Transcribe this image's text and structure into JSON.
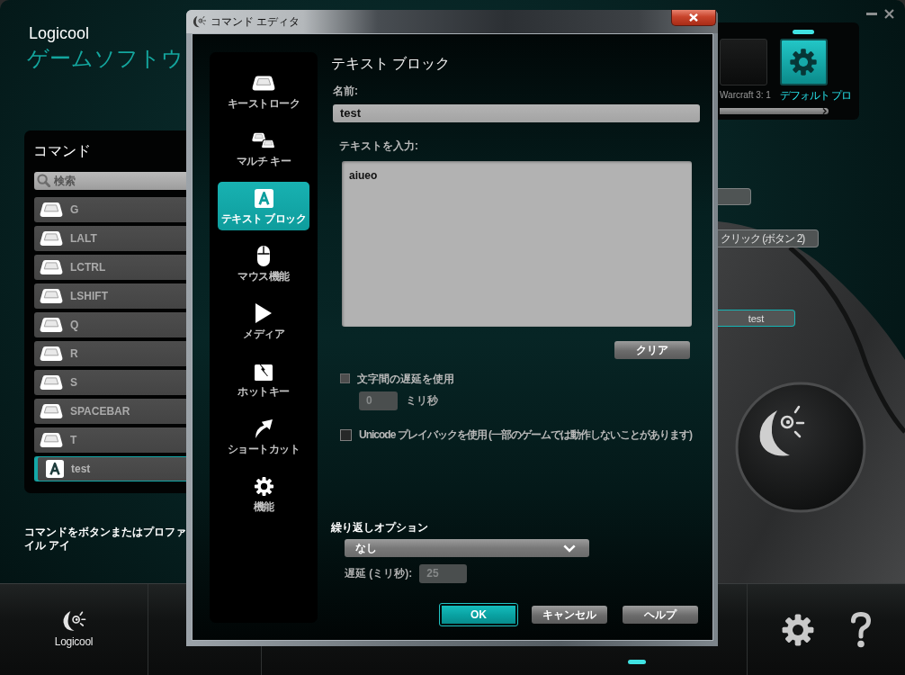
{
  "app": {
    "brand": "Logicool",
    "product_title": "ゲームソフトウ"
  },
  "commands": {
    "title": "コマンド",
    "search": {
      "placeholder": "検索"
    },
    "items": [
      {
        "label": "G",
        "kind": "key",
        "selected": false
      },
      {
        "label": "LALT",
        "kind": "key",
        "selected": false
      },
      {
        "label": "LCTRL",
        "kind": "key",
        "selected": false
      },
      {
        "label": "LSHIFT",
        "kind": "key",
        "selected": false
      },
      {
        "label": "Q",
        "kind": "key",
        "selected": false
      },
      {
        "label": "R",
        "kind": "key",
        "selected": false
      },
      {
        "label": "S",
        "kind": "key",
        "selected": false
      },
      {
        "label": "SPACEBAR",
        "kind": "key",
        "selected": false
      },
      {
        "label": "T",
        "kind": "key",
        "selected": false
      },
      {
        "label": "test",
        "kind": "text",
        "selected": true
      }
    ],
    "hint": "コマンドをボタンまたはプロファイル アイ"
  },
  "profiles": {
    "items": [
      {
        "label": "Warcraft 3: 1",
        "kind": "game",
        "selected": false
      },
      {
        "label": "デフォルト プロ",
        "kind": "default",
        "selected": true
      }
    ]
  },
  "assignments": [
    {
      "selected": false
    },
    {
      "label": "クリック (ボタン 2)",
      "selected": false
    },
    {
      "label": "test",
      "selected": true
    }
  ],
  "bottom_bar": {
    "brand": "Logicool"
  },
  "dialog": {
    "title": "コマンド エディタ",
    "nav": [
      {
        "label": "キーストローク",
        "kind": "keystroke",
        "selected": false
      },
      {
        "label": "マルチ キー",
        "kind": "multikey",
        "selected": false
      },
      {
        "label": "テキスト ブロック",
        "kind": "textblock",
        "selected": true
      },
      {
        "label": "マウス機能",
        "kind": "mouse",
        "selected": false
      },
      {
        "label": "メディア",
        "kind": "media",
        "selected": false
      },
      {
        "label": "ホットキー",
        "kind": "hotkey",
        "selected": false
      },
      {
        "label": "ショートカット",
        "kind": "shortcut",
        "selected": false
      },
      {
        "label": "機能",
        "kind": "function",
        "selected": false
      }
    ],
    "heading": "テキスト ブロック",
    "name_label": "名前:",
    "name_value": "test",
    "text_label": "テキストを入力:",
    "text_value": "aiueo",
    "clear_button": "クリア",
    "char_delay": {
      "label": "文字間の遅延を使用",
      "checked": false,
      "value": "0",
      "disabled": true,
      "unit": "ミリ秒"
    },
    "unicode_playback": {
      "label": "Unicode プレイバックを使用 (一部のゲームでは動作しないことがあります)",
      "checked": false
    },
    "repeat": {
      "label": "繰り返しオプション",
      "value": "なし",
      "delay_label": "遅延 (ミリ秒):",
      "delay_value": "25",
      "delay_disabled": true
    },
    "buttons": [
      {
        "label": "OK",
        "kind": "primary"
      },
      {
        "label": "キャンセル",
        "kind": "normal"
      },
      {
        "label": "ヘルプ",
        "kind": "normal"
      }
    ]
  }
}
